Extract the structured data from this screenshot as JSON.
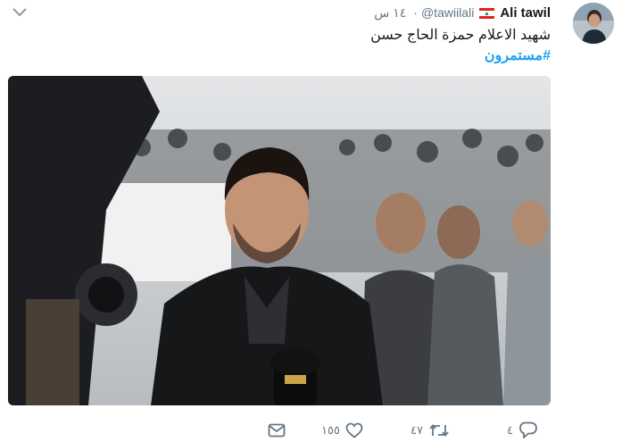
{
  "tweet": {
    "author_name": "Ali tawil",
    "author_handle": "@tawiilali",
    "separator": "·",
    "time": "١٤ س",
    "text": "شهيد الاعلام حمزة الحاج حسن",
    "hashtag": "#مستمرون",
    "flag": "lebanon-flag-icon"
  },
  "actions": {
    "reply_count": "٤",
    "retweet_count": "٤٧",
    "like_count": "١٥٥"
  },
  "colors": {
    "accent": "#1da1f2",
    "muted": "#657786",
    "text": "#14171a"
  },
  "icons": [
    "chevron-down-icon",
    "reply-icon",
    "retweet-icon",
    "like-icon",
    "direct-message-icon"
  ]
}
